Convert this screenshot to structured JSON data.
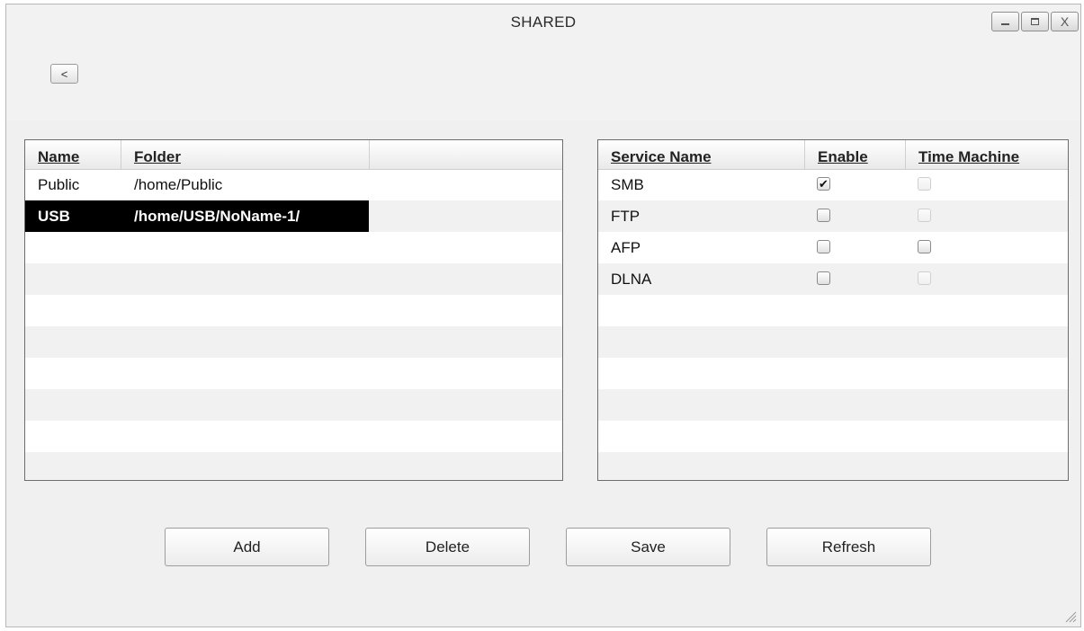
{
  "window": {
    "title": "SHARED"
  },
  "window_controls": {
    "minimize_icon": "minimize-icon",
    "maximize_icon": "maximize-icon",
    "close_label": "X"
  },
  "nav": {
    "back_label": "<"
  },
  "shares_table": {
    "columns": [
      "Name",
      "Folder",
      ""
    ],
    "rows": [
      {
        "name": "Public",
        "folder": "/home/Public",
        "selected": false
      },
      {
        "name": "USB",
        "folder": "/home/USB/NoName-1/",
        "selected": true
      }
    ]
  },
  "services_table": {
    "columns": [
      "Service Name",
      "Enable",
      "Time Machine"
    ],
    "rows": [
      {
        "service": "SMB",
        "enabled": true,
        "time_machine": false,
        "time_machine_disabled": true
      },
      {
        "service": "FTP",
        "enabled": false,
        "time_machine": false,
        "time_machine_disabled": true
      },
      {
        "service": "AFP",
        "enabled": false,
        "time_machine": false,
        "time_machine_disabled": false
      },
      {
        "service": "DLNA",
        "enabled": false,
        "time_machine": false,
        "time_machine_disabled": true
      }
    ]
  },
  "buttons": {
    "add": "Add",
    "delete": "Delete",
    "save": "Save",
    "refresh": "Refresh"
  },
  "check_mark": "✔"
}
